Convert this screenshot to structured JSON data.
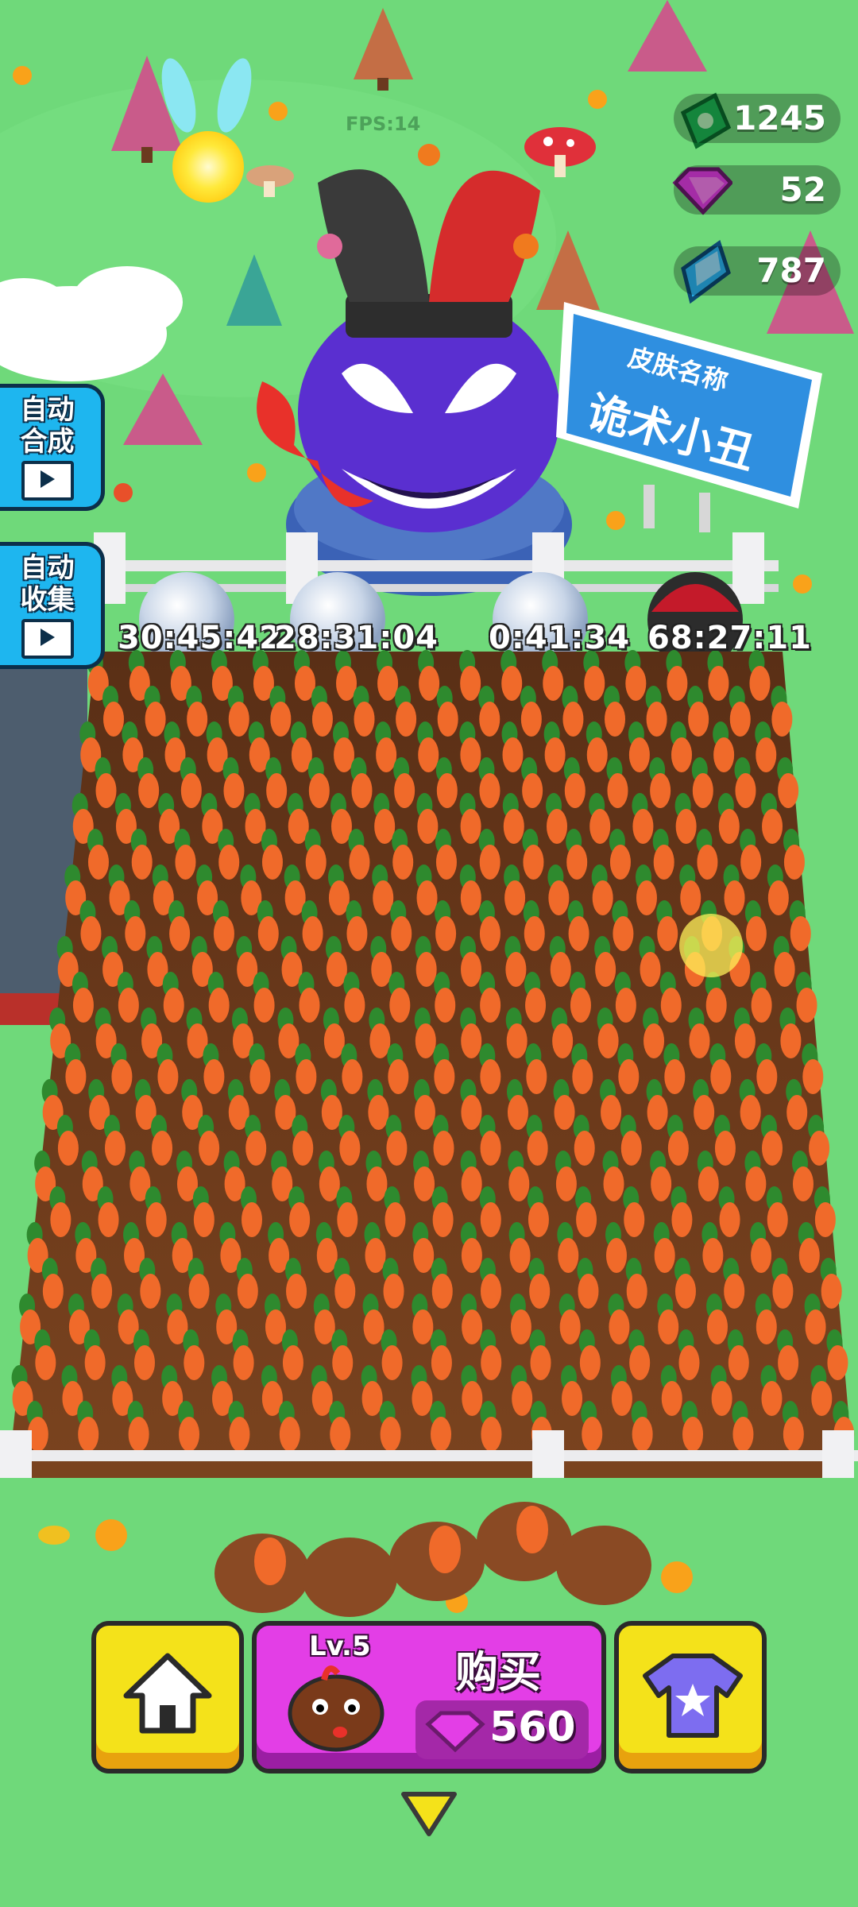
{
  "hud": {
    "fps": "FPS:14",
    "cash": "1245",
    "pink_gems": "52",
    "blue_gems": "787"
  },
  "side_buttons": [
    {
      "label": "自动合成",
      "icon": "video-ad-icon"
    },
    {
      "label": "自动收集",
      "icon": "video-ad-icon"
    }
  ],
  "sign": {
    "title": "皮肤名称",
    "name": "诡术小丑"
  },
  "timers": [
    "30:45:42",
    "28:31:04",
    "0:41:34",
    "68:27:11"
  ],
  "bottom_bar": {
    "home_icon": "home-icon",
    "buy": {
      "level": "Lv.5",
      "label": "购买",
      "price": "560",
      "currency_icon": "pink-gem-icon"
    },
    "shop_icon": "tshirt-star-icon"
  },
  "colors": {
    "grass": "#6fd97a",
    "soil": "#6b3a1f",
    "carrot": "#f06a2a",
    "leaf": "#2e8a2e",
    "button_yellow": "#f4e21a",
    "button_pink": "#e33ee6",
    "side_blue": "#1eb6ef"
  }
}
